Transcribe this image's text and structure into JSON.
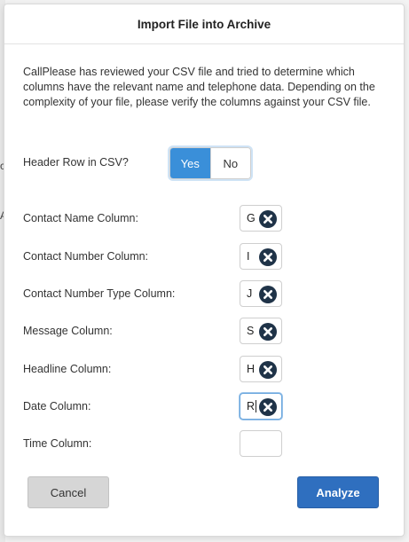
{
  "background": {
    "fragments": [
      "c",
      "A"
    ]
  },
  "dialog": {
    "title": "Import File into Archive",
    "intro": "CallPlease has reviewed your CSV file and tried to determine which columns have the relevant name and telephone data. Depending on the complexity of your file, please verify the columns against your CSV file.",
    "header_row": {
      "label": "Header Row in CSV?",
      "options": [
        "Yes",
        "No"
      ],
      "selected": "Yes"
    },
    "columns": [
      {
        "label": "Contact Name Column:",
        "value": "G"
      },
      {
        "label": "Contact Number Column:",
        "value": "I"
      },
      {
        "label": "Contact Number Type Column:",
        "value": "J"
      },
      {
        "label": "Message Column:",
        "value": "S"
      },
      {
        "label": "Headline Column:",
        "value": "H"
      },
      {
        "label": "Date Column:",
        "value": "R"
      },
      {
        "label": "Time Column:",
        "value": ""
      }
    ],
    "buttons": {
      "cancel": "Cancel",
      "analyze": "Analyze"
    },
    "colors": {
      "toggle_active": "#3a8fd9",
      "primary_button": "#2f6fbf",
      "clear_icon": "#1f3348"
    },
    "icons": {
      "clear": "close-circle-icon"
    }
  }
}
